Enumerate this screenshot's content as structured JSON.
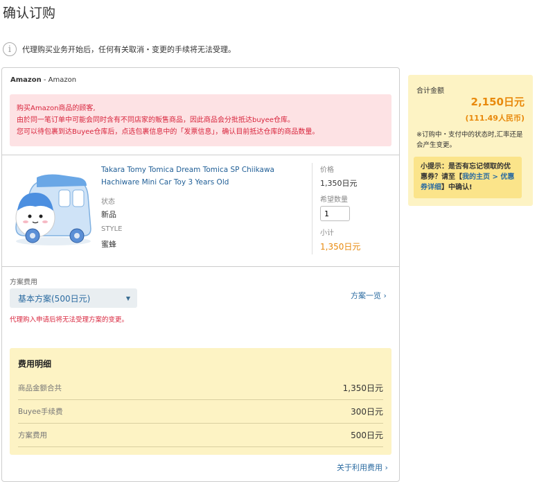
{
  "page": {
    "title": "确认订购"
  },
  "notice": {
    "text": "代理购买业务开始后，任何有关取消・变更的手续将无法受理。",
    "icon": "info-icon"
  },
  "seller": {
    "name": "Amazon",
    "sub": " - Amazon"
  },
  "alert": {
    "line1": "购买Amazon商品的顾客,",
    "line2": "由於同一笔订单中可能会同时含有不同店家的販售商品，因此商品会分批抵达buyee仓库。",
    "line3": "您可以待包裹到达Buyee仓库后，点选包裹信息中的「发票信息」，确认目前抵达仓库的商品数量。"
  },
  "item": {
    "name": "Takara Tomy Tomica Dream Tomica SP Chiikawa Hachiware Mini Car Toy 3 Years Old",
    "status_label": "状态",
    "status_value": "新品",
    "style_label": "STYLE",
    "style_value": "蜜蜂",
    "price_label": "价格",
    "price_value": "1,350日元",
    "qty_label": "希望数量",
    "qty_value": "1",
    "subtotal_label": "小计",
    "subtotal_value": "1,350日元"
  },
  "plan": {
    "label": "方案费用",
    "selected": "基本方案(500日元)",
    "list_link": "方案一览",
    "warning": "代理购入申请后将无法受理方案的变更。"
  },
  "fees": {
    "title": "费用明细",
    "rows": [
      {
        "label": "商品金额合共",
        "amount": "1,350日元"
      },
      {
        "label": "Buyee手续费",
        "amount": "300日元"
      },
      {
        "label": "方案费用",
        "amount": "500日元"
      }
    ],
    "link": "关于利用费用"
  },
  "summary": {
    "label": "合计金额",
    "total": "2,150日元",
    "rmb": "(111.49人民币)",
    "note": "※订购中・支付中的状态时,汇率还是会产生变更。",
    "tip_prefix": "小提示：是否有忘记领取的优惠券？请至【",
    "tip_link1": "我的主页",
    "tip_sep": " > ",
    "tip_link2": "优惠券详细",
    "tip_suffix": "】中确认!"
  },
  "colors": {
    "accent": "#e8890c",
    "link": "#2a6aa0",
    "alert": "#d8243c",
    "fee_bg": "#fdf3c4"
  }
}
